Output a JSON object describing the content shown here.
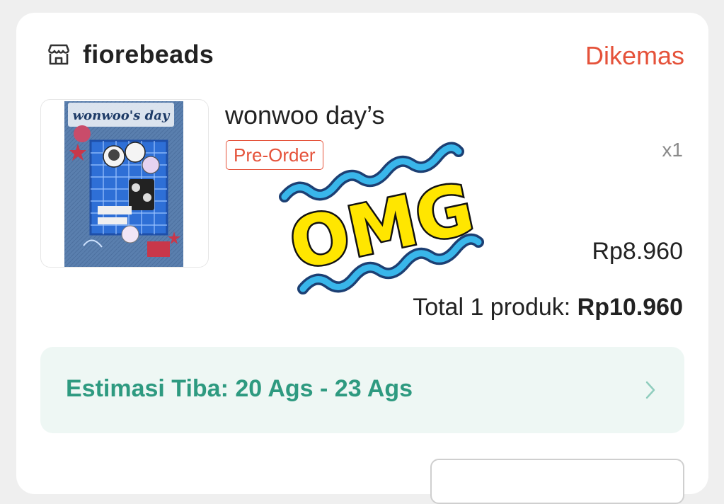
{
  "shop": {
    "name": "fiorebeads",
    "status": "Dikemas",
    "icon": "store-icon"
  },
  "product": {
    "name": "wonwoo day’s",
    "tag": "Pre-Order",
    "qty": "x1",
    "price": "Rp8.960",
    "thumbnail_title": "wonwoo's day"
  },
  "total": {
    "label": "Total 1 produk: ",
    "amount": "Rp10.960"
  },
  "delivery": {
    "eta": "Estimasi Tiba: 20 Ags - 23 Ags",
    "icon": "chevron-right-icon"
  },
  "sticker": {
    "text": "OMG"
  },
  "colors": {
    "accent_red": "#e5523a",
    "eta_green": "#2e9a80",
    "eta_bg": "#eef7f4",
    "sticker_yellow": "#ffe600",
    "sticker_blue": "#39b6ea"
  }
}
